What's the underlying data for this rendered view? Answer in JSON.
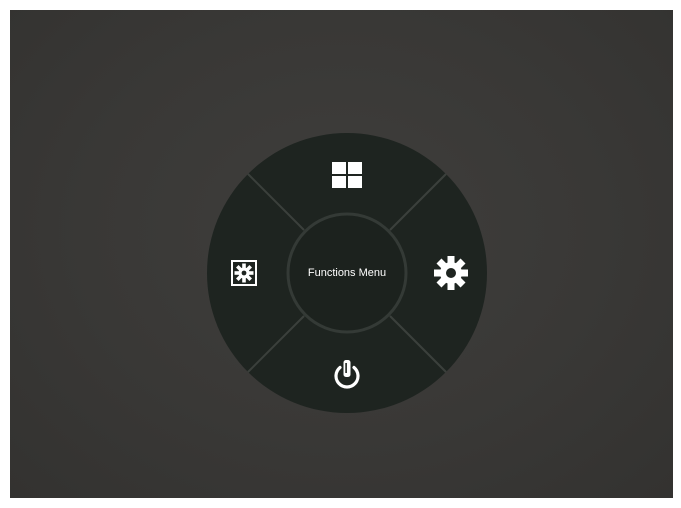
{
  "menu": {
    "center_label": "Functions Menu",
    "items": [
      {
        "position": "top",
        "icon": "grid-icon"
      },
      {
        "position": "right",
        "icon": "gear-icon"
      },
      {
        "position": "bottom",
        "icon": "power-icon"
      },
      {
        "position": "left",
        "icon": "brightness-settings-icon"
      }
    ]
  },
  "colors": {
    "background": "#393836",
    "segment": "#1e2420",
    "divider": "#3a3f3b",
    "icon": "#ffffff"
  }
}
